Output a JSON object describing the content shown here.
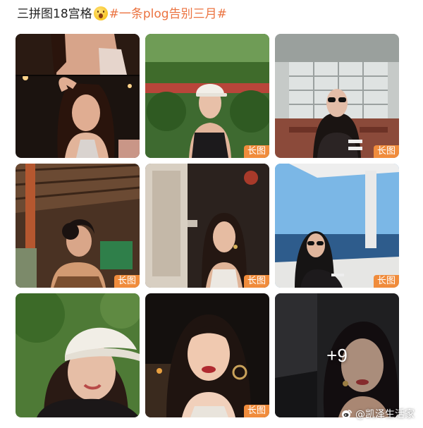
{
  "post": {
    "text_prefix": "三拼图18宫格",
    "emoji": "astonished-face",
    "hashtag": "#一条plog告别三月#"
  },
  "grid": {
    "badge_label": "长图",
    "more_label": "+9",
    "tiles": [
      {
        "name": "photo-1",
        "badge": false
      },
      {
        "name": "photo-2",
        "badge": true
      },
      {
        "name": "photo-3",
        "badge": true
      },
      {
        "name": "photo-4",
        "badge": true
      },
      {
        "name": "photo-5",
        "badge": true
      },
      {
        "name": "photo-6",
        "badge": true
      },
      {
        "name": "photo-7",
        "badge": false
      },
      {
        "name": "photo-8",
        "badge": true
      },
      {
        "name": "photo-9",
        "badge": false,
        "overlay": true
      }
    ]
  },
  "watermark": {
    "text": "@凯泽生活家",
    "icon": "weibo-logo-icon"
  }
}
